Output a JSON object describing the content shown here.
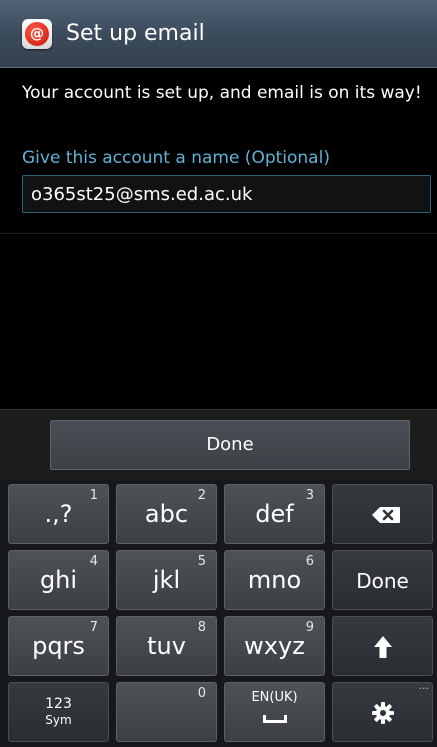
{
  "header": {
    "title": "Set up email",
    "app_icon_glyph": "@",
    "app_icon": "email-app-icon"
  },
  "content": {
    "message": "Your account is set up, and email is on its way!",
    "field_label": "Give this account a name (Optional)",
    "account_name_value": "o365st25@sms.ed.ac.uk"
  },
  "actions": {
    "done_label": "Done"
  },
  "keyboard": {
    "row1": [
      {
        "main": ".,?",
        "sup": "1"
      },
      {
        "main": "abc",
        "sup": "2"
      },
      {
        "main": "def",
        "sup": "3"
      },
      {
        "icon": "backspace-icon"
      }
    ],
    "row2": [
      {
        "main": "ghi",
        "sup": "4"
      },
      {
        "main": "jkl",
        "sup": "5"
      },
      {
        "main": "mno",
        "sup": "6"
      },
      {
        "main": "Done"
      }
    ],
    "row3": [
      {
        "main": "pqrs",
        "sup": "7"
      },
      {
        "main": "tuv",
        "sup": "8"
      },
      {
        "main": "wxyz",
        "sup": "9"
      },
      {
        "icon": "arrow-up-icon",
        "glyph": "🡅"
      }
    ],
    "row4": [
      {
        "top": "123",
        "bottom": "Sym"
      },
      {
        "sup": "0"
      },
      {
        "lang": "EN(UK)",
        "icon": "space-icon"
      },
      {
        "icon": "gear-icon",
        "glyph": "✿",
        "more": "···"
      }
    ]
  },
  "colors": {
    "title_bar": "#3b4a5b",
    "accent": "#5fb2d4",
    "background": "#000000",
    "key": "#43484d"
  }
}
